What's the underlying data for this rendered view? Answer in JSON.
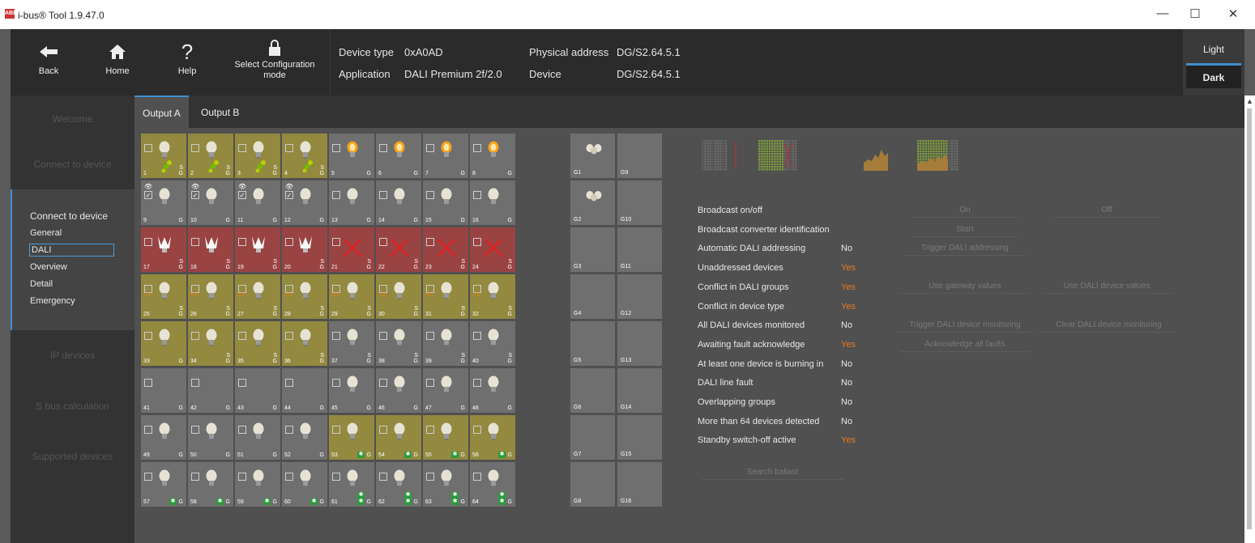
{
  "window": {
    "title": "i-bus® Tool 1.9.47.0",
    "logo": "ABB",
    "minimize": "—",
    "maximize": "☐",
    "close": "✕"
  },
  "toolbar": {
    "back": "Back",
    "home": "Home",
    "help": "Help",
    "select_config": "Select Configuration mode",
    "device_type_label": "Device type",
    "device_type_value": "0xA0AD",
    "application_label": "Application",
    "application_value": "DALI Premium 2f/2.0",
    "physical_address_label": "Physical address",
    "physical_address_value": "DG/S2.64.5.1",
    "device_label": "Device",
    "device_value": "DG/S2.64.5.1",
    "theme_light": "Light",
    "theme_dark": "Dark"
  },
  "sidebar": {
    "welcome": "Welcome",
    "connect": "Connect to device",
    "group_title": "Connect to device",
    "items": [
      "General",
      "DALI",
      "Overview",
      "Detail",
      "Emergency"
    ],
    "ip_devices": "IP devices",
    "sbus": "S bus calculation",
    "supported": "Supported devices"
  },
  "tabs": [
    "Output A",
    "Output B"
  ],
  "grid": {
    "s_label": "S",
    "g_label": "G",
    "ln_label": "LN",
    "em_label": "✱",
    "cells": [
      {
        "n": "1",
        "c": "y",
        "b": "w",
        "s": true,
        "dots": true
      },
      {
        "n": "2",
        "c": "y",
        "b": "w",
        "s": true,
        "dots": true
      },
      {
        "n": "3",
        "c": "y",
        "b": "w",
        "s": true,
        "dots": true
      },
      {
        "n": "4",
        "c": "y",
        "b": "w",
        "s": true,
        "dots": true
      },
      {
        "n": "5",
        "c": "g",
        "b": "o"
      },
      {
        "n": "6",
        "c": "g",
        "b": "o"
      },
      {
        "n": "7",
        "c": "g",
        "b": "o"
      },
      {
        "n": "8",
        "c": "g",
        "b": "o"
      },
      {
        "n": "9",
        "c": "g",
        "b": "w",
        "eye": true,
        "chk": "✓"
      },
      {
        "n": "10",
        "c": "g",
        "b": "w",
        "eye": true,
        "chk": "✓"
      },
      {
        "n": "11",
        "c": "g",
        "b": "w",
        "eye": true,
        "chk": "✓"
      },
      {
        "n": "12",
        "c": "g",
        "b": "w",
        "eye": true,
        "chk": "✓"
      },
      {
        "n": "13",
        "c": "g",
        "b": "w"
      },
      {
        "n": "14",
        "c": "g",
        "b": "w"
      },
      {
        "n": "15",
        "c": "g",
        "b": "w"
      },
      {
        "n": "16",
        "c": "g",
        "b": "w"
      },
      {
        "n": "17",
        "c": "r",
        "b": "f",
        "s": true
      },
      {
        "n": "18",
        "c": "r",
        "b": "f",
        "s": true
      },
      {
        "n": "19",
        "c": "r",
        "b": "f",
        "s": true
      },
      {
        "n": "20",
        "c": "r",
        "b": "f",
        "s": true
      },
      {
        "n": "21",
        "c": "r",
        "b": "x",
        "s": true
      },
      {
        "n": "22",
        "c": "r",
        "b": "x",
        "s": true
      },
      {
        "n": "23",
        "c": "r",
        "b": "x",
        "s": true
      },
      {
        "n": "24",
        "c": "r",
        "b": "x",
        "s": true
      },
      {
        "n": "25",
        "c": "y",
        "b": "w",
        "s": true,
        "ln": true
      },
      {
        "n": "26",
        "c": "y",
        "b": "w",
        "s": true,
        "ln": true
      },
      {
        "n": "27",
        "c": "y",
        "b": "w",
        "s": true,
        "ln": true
      },
      {
        "n": "28",
        "c": "y",
        "b": "w",
        "s": true,
        "ln": true
      },
      {
        "n": "29",
        "c": "y",
        "b": "w",
        "s": true,
        "ln": true
      },
      {
        "n": "30",
        "c": "y",
        "b": "w",
        "s": true,
        "ln": true
      },
      {
        "n": "31",
        "c": "y",
        "b": "w",
        "s": true,
        "ln": true
      },
      {
        "n": "32",
        "c": "y",
        "b": "w",
        "s": true,
        "ln": true
      },
      {
        "n": "33",
        "c": "y",
        "b": "w"
      },
      {
        "n": "34",
        "c": "y",
        "b": "w",
        "s": true
      },
      {
        "n": "35",
        "c": "y",
        "b": "w",
        "s": true
      },
      {
        "n": "36",
        "c": "y",
        "b": "w",
        "s": true
      },
      {
        "n": "37",
        "c": "g",
        "b": "w",
        "s": true
      },
      {
        "n": "38",
        "c": "g",
        "b": "w",
        "s": true
      },
      {
        "n": "39",
        "c": "g",
        "b": "w",
        "s": true
      },
      {
        "n": "40",
        "c": "g",
        "b": "w",
        "s": true
      },
      {
        "n": "41",
        "c": "g",
        "b": ""
      },
      {
        "n": "42",
        "c": "g",
        "b": ""
      },
      {
        "n": "43",
        "c": "g",
        "b": ""
      },
      {
        "n": "44",
        "c": "g",
        "b": ""
      },
      {
        "n": "45",
        "c": "g",
        "b": "w"
      },
      {
        "n": "46",
        "c": "g",
        "b": "w"
      },
      {
        "n": "47",
        "c": "g",
        "b": "w"
      },
      {
        "n": "48",
        "c": "g",
        "b": "w"
      },
      {
        "n": "49",
        "c": "g",
        "b": "w"
      },
      {
        "n": "50",
        "c": "g",
        "b": "w"
      },
      {
        "n": "51",
        "c": "g",
        "b": "w"
      },
      {
        "n": "52",
        "c": "g",
        "b": "w"
      },
      {
        "n": "53",
        "c": "y",
        "b": "w",
        "em": 1
      },
      {
        "n": "54",
        "c": "y",
        "b": "w",
        "em": 1
      },
      {
        "n": "55",
        "c": "y",
        "b": "w",
        "em": 1
      },
      {
        "n": "56",
        "c": "y",
        "b": "w",
        "em": 1
      },
      {
        "n": "57",
        "c": "g",
        "b": "w",
        "em": 2
      },
      {
        "n": "58",
        "c": "g",
        "b": "w",
        "em": 2
      },
      {
        "n": "59",
        "c": "g",
        "b": "w",
        "em": 2
      },
      {
        "n": "60",
        "c": "g",
        "b": "w",
        "em": 2
      },
      {
        "n": "61",
        "c": "g",
        "b": "w",
        "em": 3
      },
      {
        "n": "62",
        "c": "g",
        "b": "w",
        "em": 3
      },
      {
        "n": "63",
        "c": "g",
        "b": "w",
        "em": 3
      },
      {
        "n": "64",
        "c": "g",
        "b": "w",
        "em": 3
      }
    ],
    "groups_left": [
      "G1",
      "G2",
      "G3",
      "G4",
      "G5",
      "G6",
      "G7",
      "G8"
    ],
    "groups_right": [
      "G9",
      "G10",
      "G11",
      "G12",
      "G13",
      "G14",
      "G15",
      "G16"
    ]
  },
  "status": {
    "rows": [
      {
        "label": "Broadcast on/off",
        "value": "",
        "orange": false
      },
      {
        "label": "Broadcast converter identification",
        "value": "",
        "orange": false
      },
      {
        "label": "Automatic DALI addressing",
        "value": "No",
        "orange": false
      },
      {
        "label": "Unaddressed devices",
        "value": "Yes",
        "orange": true
      },
      {
        "label": "Conflict in DALI groups",
        "value": "Yes",
        "orange": true
      },
      {
        "label": "Conflict in device type",
        "value": "Yes",
        "orange": true
      },
      {
        "label": "All DALI devices monitored",
        "value": "No",
        "orange": false
      },
      {
        "label": "Awaiting fault acknowledge",
        "value": "Yes",
        "orange": true
      },
      {
        "label": "At least one device is burning in",
        "value": "No",
        "orange": false
      },
      {
        "label": "DALI line fault",
        "value": "No",
        "orange": false
      },
      {
        "label": "Overlapping groups",
        "value": "No",
        "orange": false
      },
      {
        "label": "More than 64 devices detected",
        "value": "No",
        "orange": false
      },
      {
        "label": "Standby switch-off active",
        "value": "Yes",
        "orange": true
      }
    ],
    "buttons": {
      "on": "On",
      "off": "Off",
      "start": "Start",
      "trigger_addressing": "Trigger DALI addressing",
      "use_gateway": "Use gateway values",
      "use_device": "Use DALI device values",
      "trigger_monitoring": "Trigger DALI device monitoring",
      "clear_monitoring": "Clear DALI device monitoring",
      "ack_faults": "Acknowledge all faults",
      "search_ballast": "Search ballast"
    }
  },
  "colors": {
    "accent": "#3f8fd0",
    "orange": "#e87a20",
    "yellow_cell": "#93893f",
    "red_cell": "#9a4343",
    "grey_cell": "#6f6f6f"
  }
}
